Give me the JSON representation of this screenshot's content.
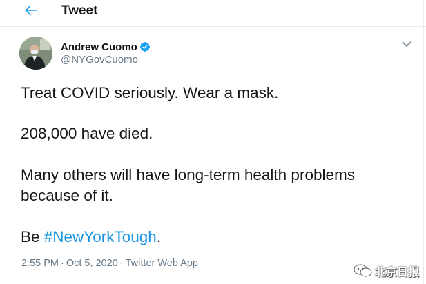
{
  "header": {
    "title": "Tweet",
    "back_icon": "arrow-left-icon"
  },
  "author": {
    "display_name": "Andrew Cuomo",
    "handle": "@NYGovCuomo",
    "verified_icon": "verified-badge-icon"
  },
  "tweet": {
    "line1": "Treat COVID seriously. Wear a mask.",
    "line2": "208,000 have died.",
    "line3": "Many others will have long-term health problems",
    "line4": "because of it.",
    "line5_prefix": "Be ",
    "hashtag": "#NewYorkTough",
    "line5_suffix": "."
  },
  "meta": {
    "time": "2:55 PM",
    "separator": "·",
    "date": "Oct 5, 2020",
    "source": "Twitter Web App"
  },
  "watermark": {
    "text": "北京日报"
  },
  "colors": {
    "accent": "#1DA1F2",
    "hashtag": "#1B95E0",
    "secondary_text": "#657786",
    "border": "#E6ECF0"
  }
}
